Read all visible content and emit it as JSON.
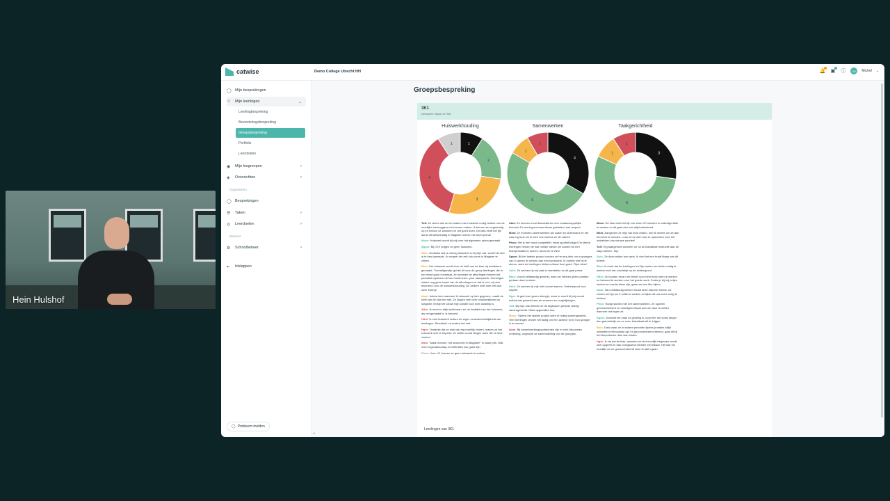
{
  "webcam": {
    "name": "Hein Hulshof"
  },
  "app": {
    "brand": "catwise",
    "school": "Demo College Utrecht HH",
    "user": {
      "initials": "MI",
      "name": "Michel"
    }
  },
  "sidebar": {
    "items": [
      {
        "label": "Mijn besprekingen",
        "icon": "chat-icon"
      },
      {
        "label": "Mijn leerlingen",
        "icon": "users-icon"
      },
      {
        "label": "Mijn lesgroepen",
        "icon": "group-icon"
      },
      {
        "label": "Overzichten",
        "icon": "dashboard-icon"
      },
      {
        "label": "Besprekingen",
        "icon": "chat-icon"
      },
      {
        "label": "Taken",
        "icon": "list-icon"
      },
      {
        "label": "Leerdoelen",
        "icon": "target-icon"
      },
      {
        "label": "Schoolbeheer",
        "icon": "settings-icon"
      },
      {
        "label": "Inklappen",
        "icon": "collapse-icon"
      }
    ],
    "sub_items": [
      "Leerlingbespreking",
      "Bevorderingsbespreking",
      "Groepsbespreking",
      "Portfolio",
      "Leerdoelen"
    ],
    "sections": [
      "Organiseren",
      "Beheren"
    ],
    "problem_button": "Probleem melden"
  },
  "main": {
    "page_title": "Groepsbespreking",
    "card_title": "3K1",
    "card_sub": "Ueesaren: Mose en Tolt",
    "students_label": "Leerlingen van 3K1"
  },
  "chart_data": [
    {
      "type": "pie",
      "title": "Huiswerkhouding",
      "labels": [
        "1",
        "2",
        "3",
        "4",
        "1"
      ],
      "values": [
        1,
        2,
        3,
        4,
        1
      ],
      "colors": [
        "#111111",
        "#7cb98a",
        "#f5b54a",
        "#d04f5a",
        "#cfcfcf"
      ]
    },
    {
      "type": "pie",
      "title": "Samenwerken",
      "labels": [
        "4",
        "6",
        "1",
        "1"
      ],
      "values": [
        4,
        6,
        1,
        1
      ],
      "colors": [
        "#111111",
        "#7cb98a",
        "#f5b54a",
        "#d04f5a"
      ]
    },
    {
      "type": "pie",
      "title": "Taakgerichtheid",
      "labels": [
        "3",
        "6",
        "1",
        "1"
      ],
      "values": [
        3,
        6,
        1,
        1
      ],
      "colors": [
        "#111111",
        "#7cb98a",
        "#f5b54a",
        "#d04f5a"
      ]
    }
  ],
  "comments": [
    [
      {
        "who": "Tolt",
        "color": "c-dark",
        "text": "Ze weten dat ze het maken van huiswerk nodig hebben om de moeilijke toetsopgaven te kunnen maken. Ik bemer hier regelmatig op en beloon ze wanneer ze het goed doen. De klas vindt het fijn dat ik dit stelselmatig in Magister noteer. Dit werkt prima!"
      },
      {
        "who": "Mose",
        "color": "c-teal",
        "text": "Huiswerk wordt bij mij over het algemeen prima gemaakt."
      },
      {
        "who": "Sgom",
        "color": "c-teal",
        "text": "Bij CKV krijgen ze geen huiswerk."
      },
      {
        "who": "Akio",
        "color": "c-orange",
        "text": "Ondanks dat ze weinig huiswerk is bij mijn vak, wordt het niet al te best gemaakt. Ik vergeet het zelf ook soms in Magister te zetten."
      },
      {
        "who": "Bkui",
        "color": "c-orange",
        "text": "Het huiswerk wordt door de helft van de klas vrij belabberd gemaakt. 'Toevalligerwijs' gelukt dit voor de groep leerlingen die er het minst goed voorstaat. Ze moesten de afkortingen binnen het periodiek systeem uit hun hoofd leren, puur stampwerk. Sommigen wisten nog geen kwart van de afkortingen en dat is voor mij dan tekenend voor de huiswerkhouding. De andere helft doet het dan weer keurig!"
      },
      {
        "who": "Idam",
        "color": "c-orange",
        "text": "Iedere keer wanneer ik huiswerk op heb gegeven, maakt de helft van de klas het niet. Ze klagen veel over onduidelijkheid op Magister, terwijl het vanuit mijn positie toch echt duidelijk is."
      },
      {
        "who": "Adrs",
        "color": "c-red",
        "text": "Ik moet er altijd achteraan, en de kwaliteit van het huiswerk, als het gemaakt is, is beroerd."
      },
      {
        "who": "Hdui",
        "color": "c-red",
        "text": "Ik vind huiswerk maken de eigen verantwoordelijkheid van leerlingen. Resultaat: ze maken het niet."
      },
      {
        "who": "Hger",
        "color": "c-red",
        "text": "Ondanks dat ze mijn vak erg moeilijk vinden, maken ze het huiswerk veel te beperkt. Ze willen vooral dingen doen die ze leuk vinden!"
      },
      {
        "who": "Mzst",
        "color": "c-red",
        "text": "\"Maar meneer, het stond niet in Magister!\" is vaste prik. Wat meer eigenaarschap en zelfkritiek zou goed zijn."
      },
      {
        "who": "Phoo",
        "color": "c-gray",
        "text": "Voor LO hoeven ze geen huiswerk te maken."
      }
    ],
    [
      {
        "who": "Akio",
        "color": "c-dark",
        "text": "Ze kunnen mooi discussiëren over maatschappelijke thema's! Er wordt goed naar elkaar geluisterd met respect."
      },
      {
        "who": "Mzst",
        "color": "c-dark",
        "text": "Ze moesten samenwerken als coach en observator en het was erg leuk om te zien hoe serieus ze dit namen."
      },
      {
        "who": "Phoo",
        "color": "c-dark",
        "text": "Het is een mooi competitief, maar sportief klasje! De sterke leerlingen helpen de wat minder sterke om samen tot een teamprestatie te komen. Mooi om te zien!"
      },
      {
        "who": "Sgom",
        "color": "c-dark",
        "text": "Bij het laatste project vonden ze het erg leuk om in groepjes van 3 samen te werken aan een kunstwerk. Ik hoefde niet bij te sturen, want de leerlingen hielpen elkaar heel goed. Fijne sfeer!"
      },
      {
        "who": "Adrs",
        "color": "c-teal",
        "text": "Ze werken bij mij vaak in tweetallen en dit gaat prima."
      },
      {
        "who": "Bkui",
        "color": "c-teal",
        "text": "Vooral zelfstandig gewerkt, want we hebben geen proefjes gedaan deze periode."
      },
      {
        "who": "Hdui",
        "color": "c-teal",
        "text": "Ze werken bij mijn niet zoveel samen. Verbeterpunt voor mijzelf!"
      },
      {
        "who": "Hger",
        "color": "c-teal",
        "text": "Ik geef een groen duimpje, maar er wordt bij mij vooral individueel gewerkt aan de sommen en vergelijkingen."
      },
      {
        "who": "Tolt",
        "color": "c-teal",
        "text": "Bij mijn vak hebben ze de afgelopen periode weinig samengewerkt. Niets opgevallen dus."
      },
      {
        "who": "Mose",
        "color": "c-orange",
        "text": "Tijdens het laatste project werd er matig samengewerkt. Veel leerlingen vinden het lastig om een actieve rol in hun groepje in te nemen."
      },
      {
        "who": "Idam",
        "color": "c-red",
        "text": "Bij samenwerkingsopdrachten zijn er veel discussies onderling, ongeacht de samenstelling van de groepjes."
      }
    ],
    [
      {
        "who": "Mose",
        "color": "c-dark",
        "text": "De klas vindt het fijn om zeker 20 minuten in volledige stilte te werken en dit gaat dan ook altijd uitstekend."
      },
      {
        "who": "Mzst",
        "color": "c-dark",
        "text": "Aangezien ze mijn vak leuk vinden, heb ik moeite om ze aan het werk te houden. Leuk om te zien hoe ze opsnuiven voor het ontdekken van nieuwe sporten!"
      },
      {
        "who": "Tolt",
        "color": "c-dark",
        "text": "Erg taakgericht wanneer ze na de klassikale instructie aan de slag moeten. Top!"
      },
      {
        "who": "Akio",
        "color": "c-teal",
        "text": "Ze doen netjes hun werk, ik vind het een braaf klasje wat dit betreft."
      },
      {
        "who": "Bkui",
        "color": "c-teal",
        "text": "Ik merk dat de leerlingen het fijn vinden om lekker rustig te werken met een muziekje op de achtergrond."
      },
      {
        "who": "Hdui",
        "color": "c-teal",
        "text": "Ze houden ervan om lekker door heel boek heen te werken en beloond te worden voor het goede werk. Zodra je bij mij netjes werken en eerder klaar zijn, gaan we een film kijken."
      },
      {
        "who": "Idam",
        "color": "c-teal",
        "text": "Van zelfstandig werken houdt deze klas het meest. Ze vinden het fijn om in stilte te werken en lijken dit ook echt nodig te hebben."
      },
      {
        "who": "Phoo",
        "color": "c-teal",
        "text": "Hangt samen met het samenwerken. Ze sporten geconcentreerd en moedigen elkaar aan om door te zetten wanneer het tegen zit."
      },
      {
        "who": "Sgom",
        "color": "c-teal",
        "text": "Doordat het vaak zo gezellig is, loopt het me soms langer dan gebruikelijk om ze even klassikaal stil te krijgen."
      },
      {
        "who": "Bkui",
        "color": "c-orange",
        "text": "Daar waar ze in andere perioden tijdens proefjes altijd ontzettend enthousiast zijn en geconcentreerd werken, gaat dit bij het theoretische deel wat minder."
      },
      {
        "who": "Hger",
        "color": "c-red",
        "text": "Ik zie dat de klas, wanneer ze stof moeilijk begrepen wordt, snel opgeeft en dan overgaat tot kletsen met elkaar. Het lukt me moeilijk om ze geconcentreerd door te laten gaan."
      }
    ]
  ]
}
